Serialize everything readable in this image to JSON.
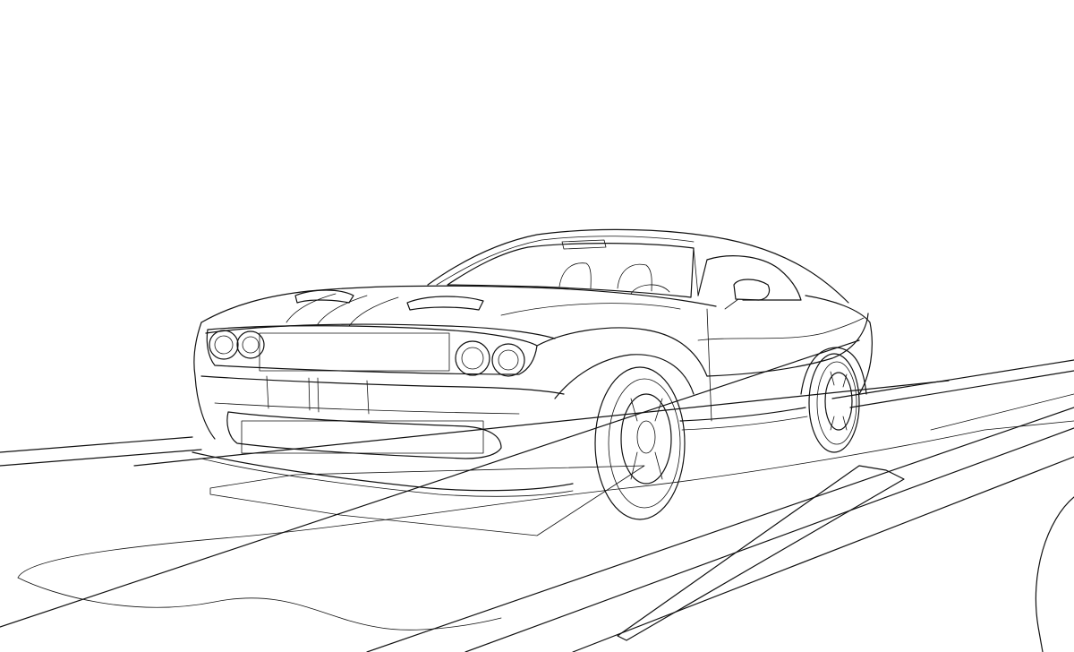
{
  "image": {
    "subject": "line-art-muscle-car",
    "style": "black-outline-coloring-page",
    "colors": {
      "background": "#ffffff",
      "stroke": "#111111"
    }
  }
}
